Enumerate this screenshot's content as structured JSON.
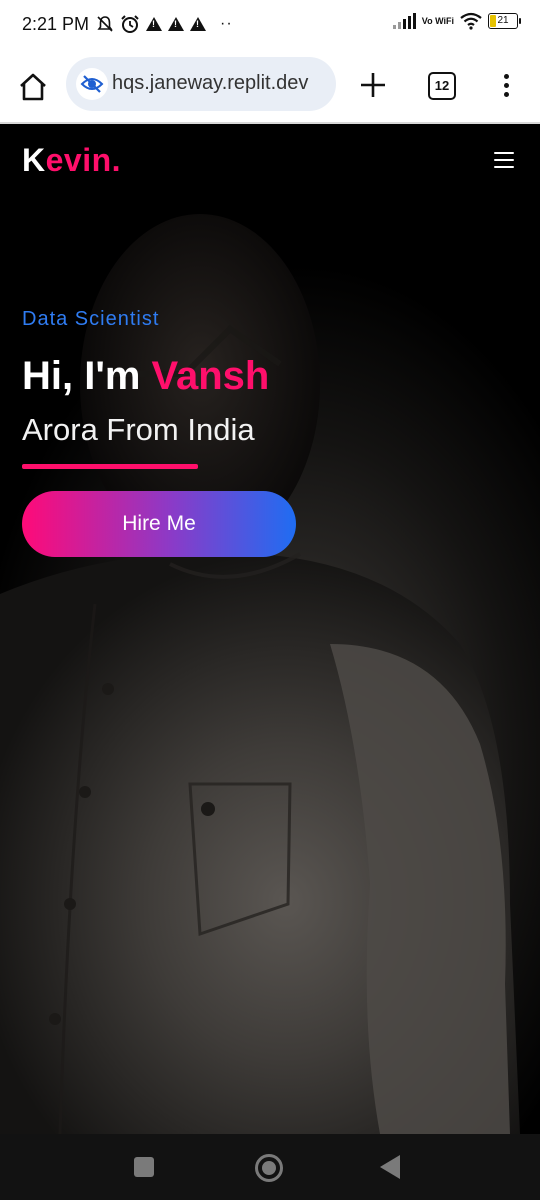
{
  "status_bar": {
    "time": "2:21 PM",
    "battery": "21",
    "network": "Vo WiFi"
  },
  "browser": {
    "url": "hqs.janeway.replit.dev",
    "tab_count": "12"
  },
  "site": {
    "logo_first": "K",
    "logo_rest": "evin.",
    "role": "Data Scientist",
    "greeting": "Hi, I'm ",
    "name": "Vansh",
    "subtitle": "Arora From India",
    "cta": "Hire Me"
  },
  "colors": {
    "accent_pink": "#ff0f6b",
    "accent_blue": "#2f7cf2",
    "background": "#000000"
  },
  "icons": [
    "silent-bell-icon",
    "alarm-icon",
    "warning-icon",
    "signal-icon",
    "wifi-icon",
    "battery-icon",
    "home-icon",
    "privacy-eye-icon",
    "plus-icon",
    "tabs-icon",
    "more-icon",
    "hamburger-icon",
    "recents-icon",
    "home-circle-icon",
    "back-icon"
  ]
}
